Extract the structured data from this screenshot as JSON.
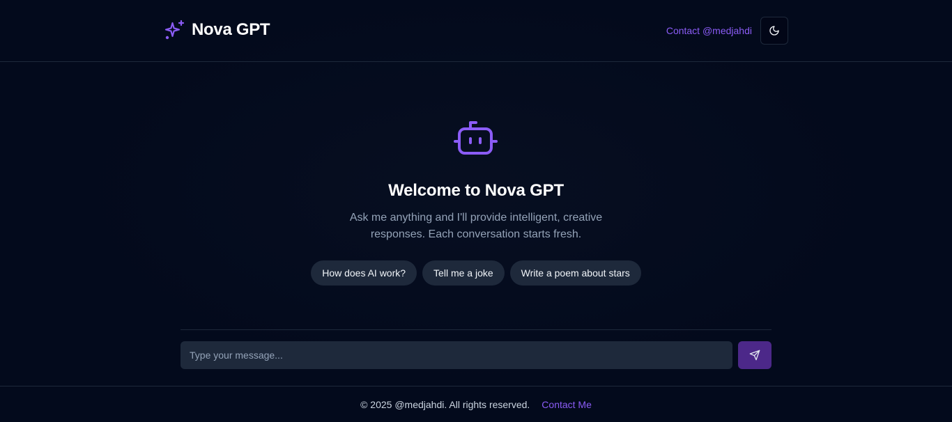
{
  "header": {
    "brand_name": "Nova GPT",
    "contact_label": "Contact @medjahdi",
    "icons": {
      "brand": "sparkles-icon",
      "theme": "moon-icon"
    }
  },
  "welcome": {
    "title": "Welcome to Nova GPT",
    "subtitle": "Ask me anything and I'll provide intelligent, creative responses. Each conversation starts fresh.",
    "icon": "bot-icon",
    "suggestions": [
      "How does AI work?",
      "Tell me a joke",
      "Write a poem about stars"
    ]
  },
  "composer": {
    "placeholder": "Type your message...",
    "value": "",
    "send_icon": "send-icon"
  },
  "footer": {
    "copyright": "© 2025 @medjahdi. All rights reserved.",
    "contact_label": "Contact Me"
  },
  "colors": {
    "background": "#030a1c",
    "accent": "#8b5cf6",
    "surface": "#1e293b",
    "send_button": "#4c2889"
  }
}
